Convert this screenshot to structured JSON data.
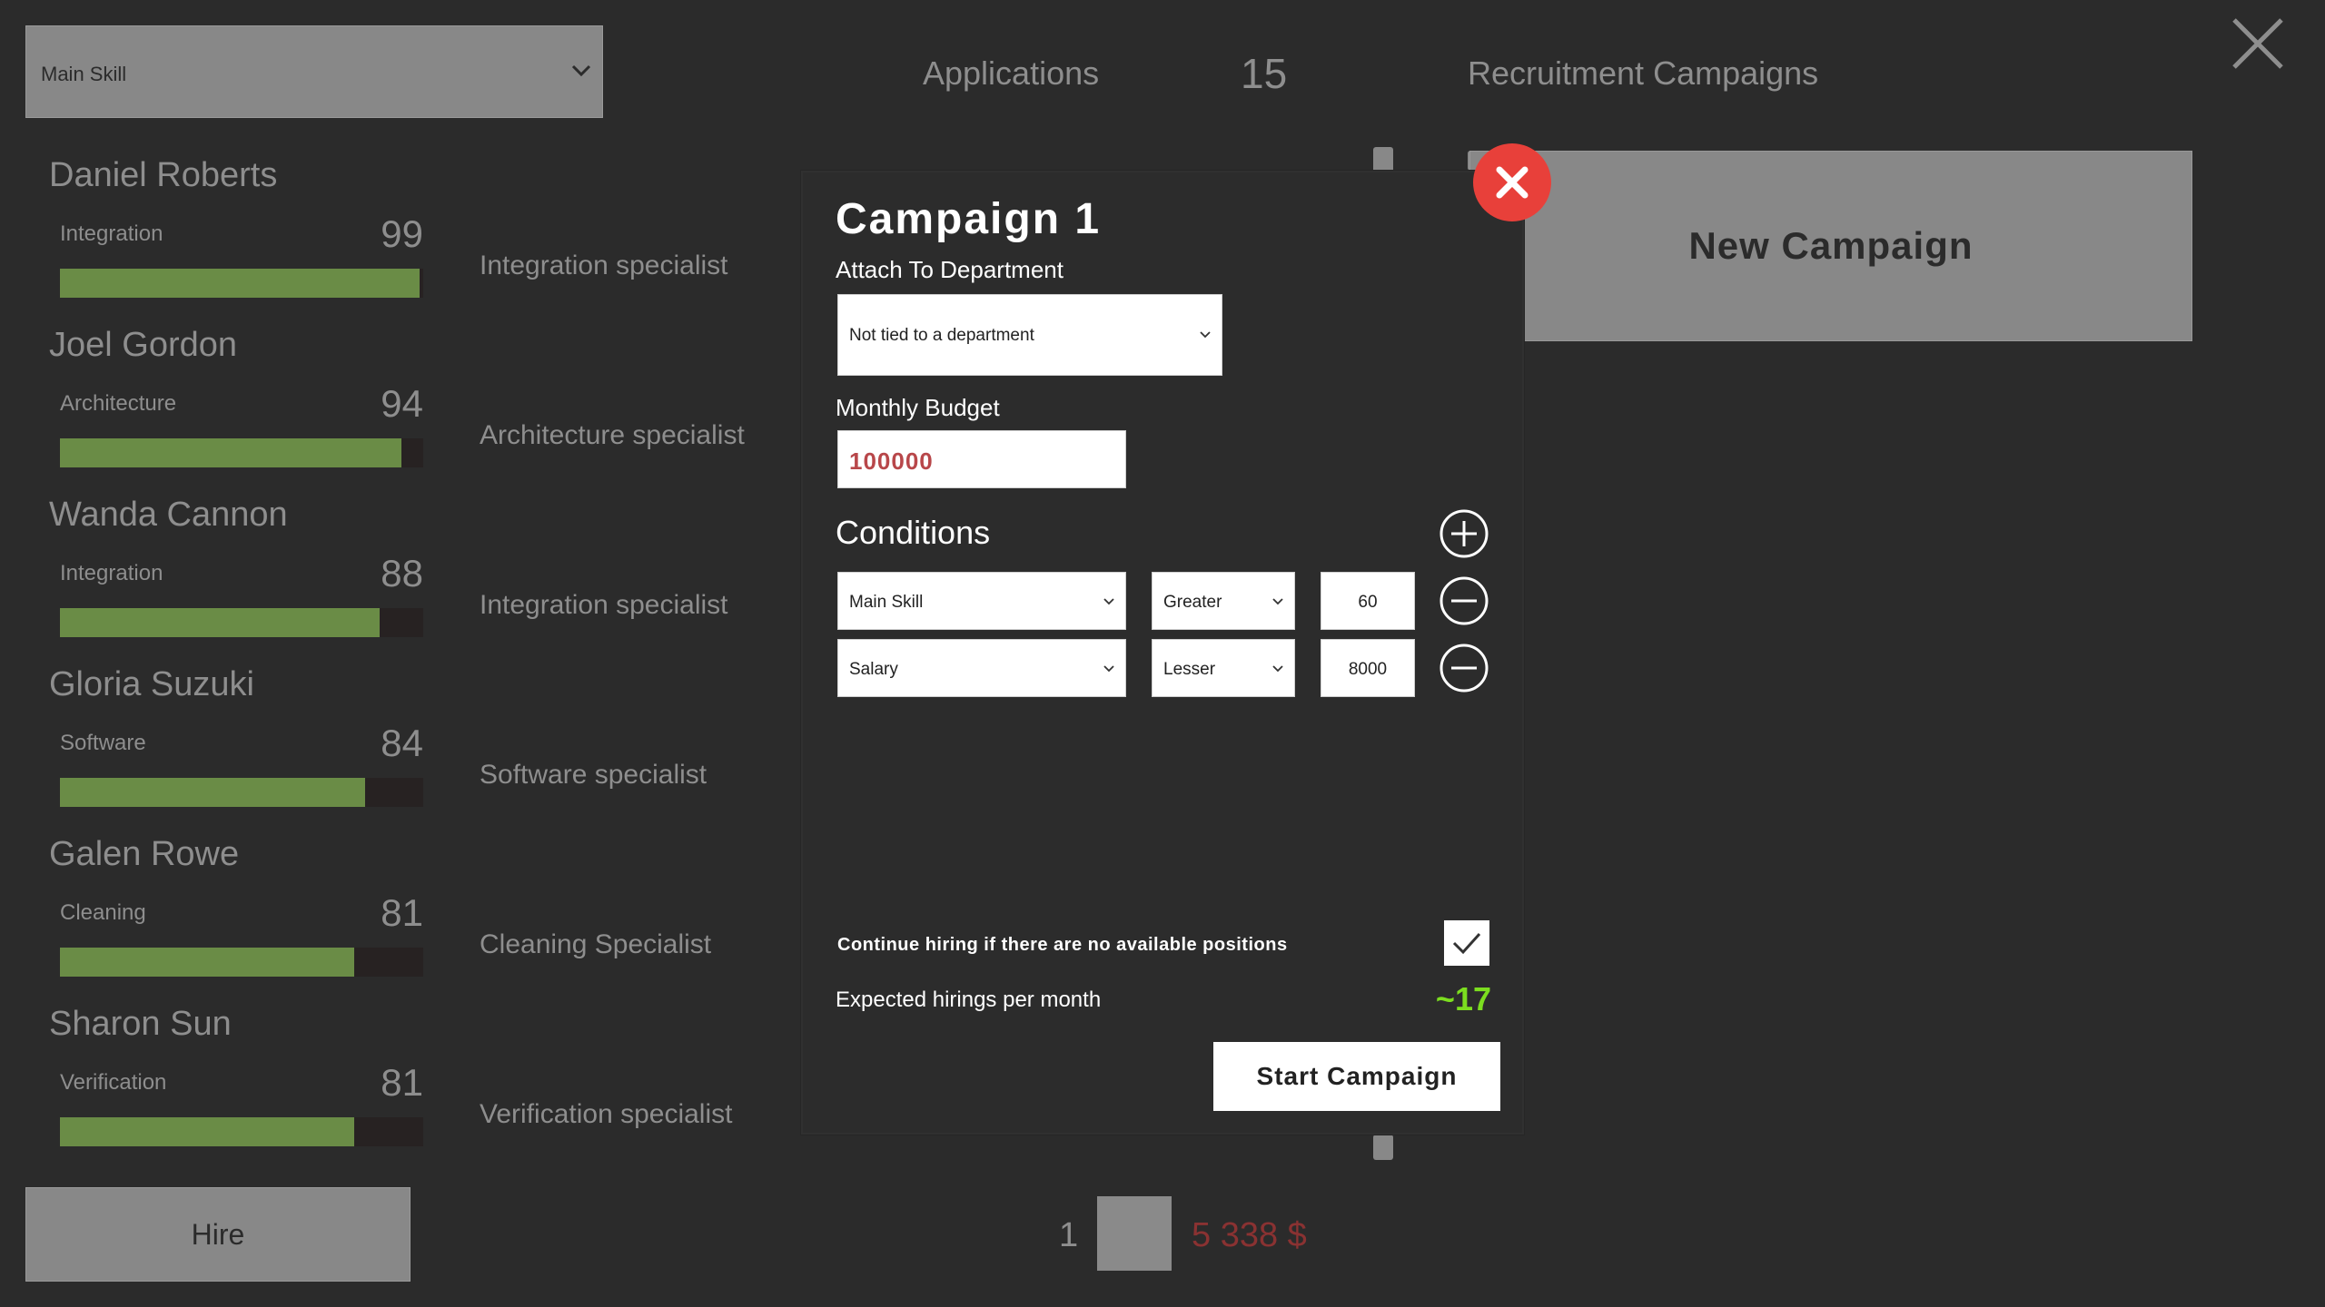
{
  "sort": {
    "selected": "Main Skill"
  },
  "header": {
    "applications_label": "Applications",
    "applications_count": "15",
    "campaigns_label": "Recruitment Campaigns"
  },
  "candidates": [
    {
      "name": "Daniel Roberts",
      "skill": "Integration",
      "score": "99",
      "level": 0.99,
      "specialization": "Integration specialist"
    },
    {
      "name": "Joel Gordon",
      "skill": "Architecture",
      "score": "94",
      "level": 0.94,
      "specialization": "Architecture specialist"
    },
    {
      "name": "Wanda Cannon",
      "skill": "Integration",
      "score": "88",
      "level": 0.88,
      "specialization": "Integration specialist"
    },
    {
      "name": "Gloria Suzuki",
      "skill": "Software",
      "score": "84",
      "level": 0.84,
      "specialization": "Software specialist"
    },
    {
      "name": "Galen Rowe",
      "skill": "Cleaning",
      "score": "81",
      "level": 0.81,
      "specialization": "Cleaning Specialist"
    },
    {
      "name": "Sharon Sun",
      "skill": "Verification",
      "score": "81",
      "level": 0.81,
      "specialization": "Verification specialist"
    }
  ],
  "hire_label": "Hire",
  "new_campaign_label": "New Campaign",
  "footer": {
    "page": "1",
    "money": "5 338 $"
  },
  "dialog": {
    "title": "Campaign 1",
    "department_label": "Attach To Department",
    "department_value": "Not tied to a department",
    "budget_label": "Monthly Budget",
    "budget_value": "100000",
    "conditions_label": "Conditions",
    "conditions": [
      {
        "field": "Main Skill",
        "operator": "Greater",
        "value": "60"
      },
      {
        "field": "Salary",
        "operator": "Lesser",
        "value": "8000"
      }
    ],
    "continue_label": "Continue hiring if there are no available positions",
    "continue_checked": true,
    "expected_label": "Expected hirings per month",
    "expected_value": "~17",
    "start_label": "Start Campaign"
  },
  "colors": {
    "background": "#2b2b2b",
    "skill_bar": "#6a8c46",
    "close_red": "#e8403a",
    "budget_text": "#b8474a",
    "expected_green": "#7cde1f",
    "money_red": "#8a3232"
  }
}
